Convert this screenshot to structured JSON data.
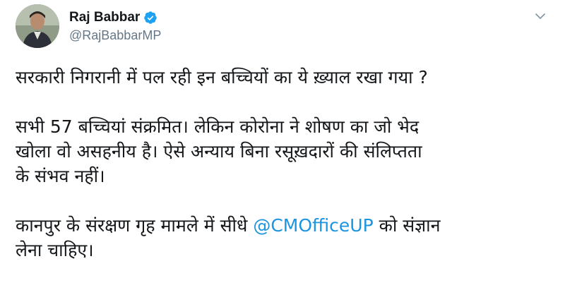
{
  "tweet": {
    "display_name": "Raj Babbar",
    "handle": "@RajBabbarMP",
    "verified": true,
    "icons": {
      "verified": "verified-badge-icon",
      "menu": "chevron-down-icon"
    },
    "paragraphs": [
      {
        "lines": [
          "सरकारी निगरानी में पल रही इन बच्चियों का ये ख़्याल रखा गया ?"
        ]
      },
      {
        "lines": [
          "सभी 57 बच्चियां संक्रमित। लेकिन कोरोना ने शोषण का जो भेद",
          "खोला वो असहनीय है। ऐसे अन्याय बिना रसूख़दारों की संलिप्तता",
          "के संभव नहीं।"
        ]
      },
      {
        "line1_before": "कानपुर के संरक्षण गृह मामले में सीधे ",
        "mention": "@CMOfficeUP",
        "line1_after": " को संज्ञान",
        "line2": "लेना चाहिए।"
      }
    ],
    "colors": {
      "text": "#14171a",
      "secondary": "#657786",
      "link": "#1b95e0",
      "verified": "#1da1f2"
    }
  }
}
